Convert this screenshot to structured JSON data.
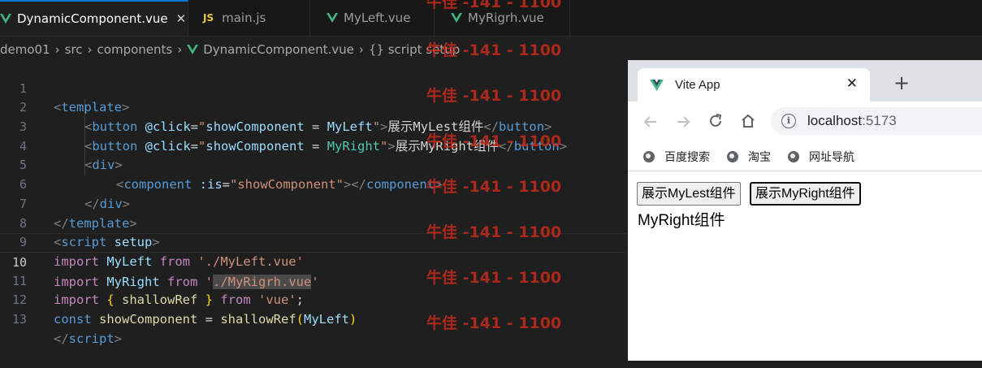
{
  "editor": {
    "tabs": [
      {
        "label": "DynamicComponent.vue",
        "icon": "vue-icon",
        "active": true
      },
      {
        "label": "main.js",
        "icon": "js-icon"
      },
      {
        "label": "MyLeft.vue",
        "icon": "vue-icon"
      },
      {
        "label": "MyRigrh.vue",
        "icon": "vue-icon"
      }
    ],
    "breadcrumb": [
      "demo01",
      "src",
      "components",
      "DynamicComponent.vue",
      "{} script setup"
    ],
    "line_numbers": [
      "1",
      "2",
      "3",
      "4",
      "5",
      "6",
      "7",
      "8",
      "9",
      "10",
      "11",
      "12",
      "13"
    ],
    "current_line": "10",
    "code": {
      "l1": {
        "a": "<",
        "b": "template",
        "c": ">"
      },
      "l2": {
        "a": "<",
        "b": "button",
        "c": " @click",
        "d": "=",
        "e": "\"",
        "f": "showComponent",
        "g": " = ",
        "h": "MyLeft",
        "i": "\"",
        "j": ">",
        "k": "展示MyLest组件",
        "l": "</",
        "m": "button",
        "n": ">"
      },
      "l3": {
        "a": "<",
        "b": "button",
        "c": " @click",
        "d": "=",
        "e": "\"",
        "f": "showComponent",
        "g": " = ",
        "h": "MyRight",
        "i": "\"",
        "j": ">",
        "k": "展示MyRight组件",
        "l": "</",
        "m": "button",
        "n": ">"
      },
      "l4": {
        "a": "<",
        "b": "div",
        "c": ">"
      },
      "l5": {
        "a": "<",
        "b": "component",
        "c": " :is",
        "d": "=",
        "e": "\"showComponent\"",
        "f": "></",
        "g": "component",
        "h": ">"
      },
      "l6": {
        "a": "</",
        "b": "div",
        "c": ">"
      },
      "l7": {
        "a": "</",
        "b": "template",
        "c": ">"
      },
      "l8": {
        "a": "<",
        "b": "script",
        "c": " setup",
        "d": ">"
      },
      "l9": {
        "a": "import",
        "b": " MyLeft ",
        "c": "from",
        "d": " ",
        "e": "'./MyLeft.vue'"
      },
      "l10": {
        "a": "import",
        "b": " MyRight ",
        "c": "from",
        "d": " '",
        "e": "./MyRigrh.vue",
        "f": "'"
      },
      "l11": {
        "a": "import",
        "b": " { ",
        "c": "shallowRef",
        "d": " } ",
        "e": "from",
        "f": " ",
        "g": "'vue'",
        "h": ";"
      },
      "l12": {
        "a": "const",
        "b": " showComponent",
        "c": " = ",
        "d": "shallowRef",
        "e": "(",
        "f": "MyLeft",
        "g": ")"
      },
      "l13": {
        "a": "</",
        "b": "script",
        "c": ">"
      }
    }
  },
  "watermark": "牛佳 -141 - 1100",
  "browser": {
    "tab_title": "Vite App",
    "tab_close": "✕",
    "new_tab": "+",
    "url_host": "localhost",
    "url_port": ":5173",
    "bookmarks": [
      "百度搜索",
      "淘宝",
      "网址导航"
    ],
    "page": {
      "buttons": [
        "展示MyLest组件",
        "展示MyRight组件"
      ],
      "text": "MyRight组件"
    }
  }
}
